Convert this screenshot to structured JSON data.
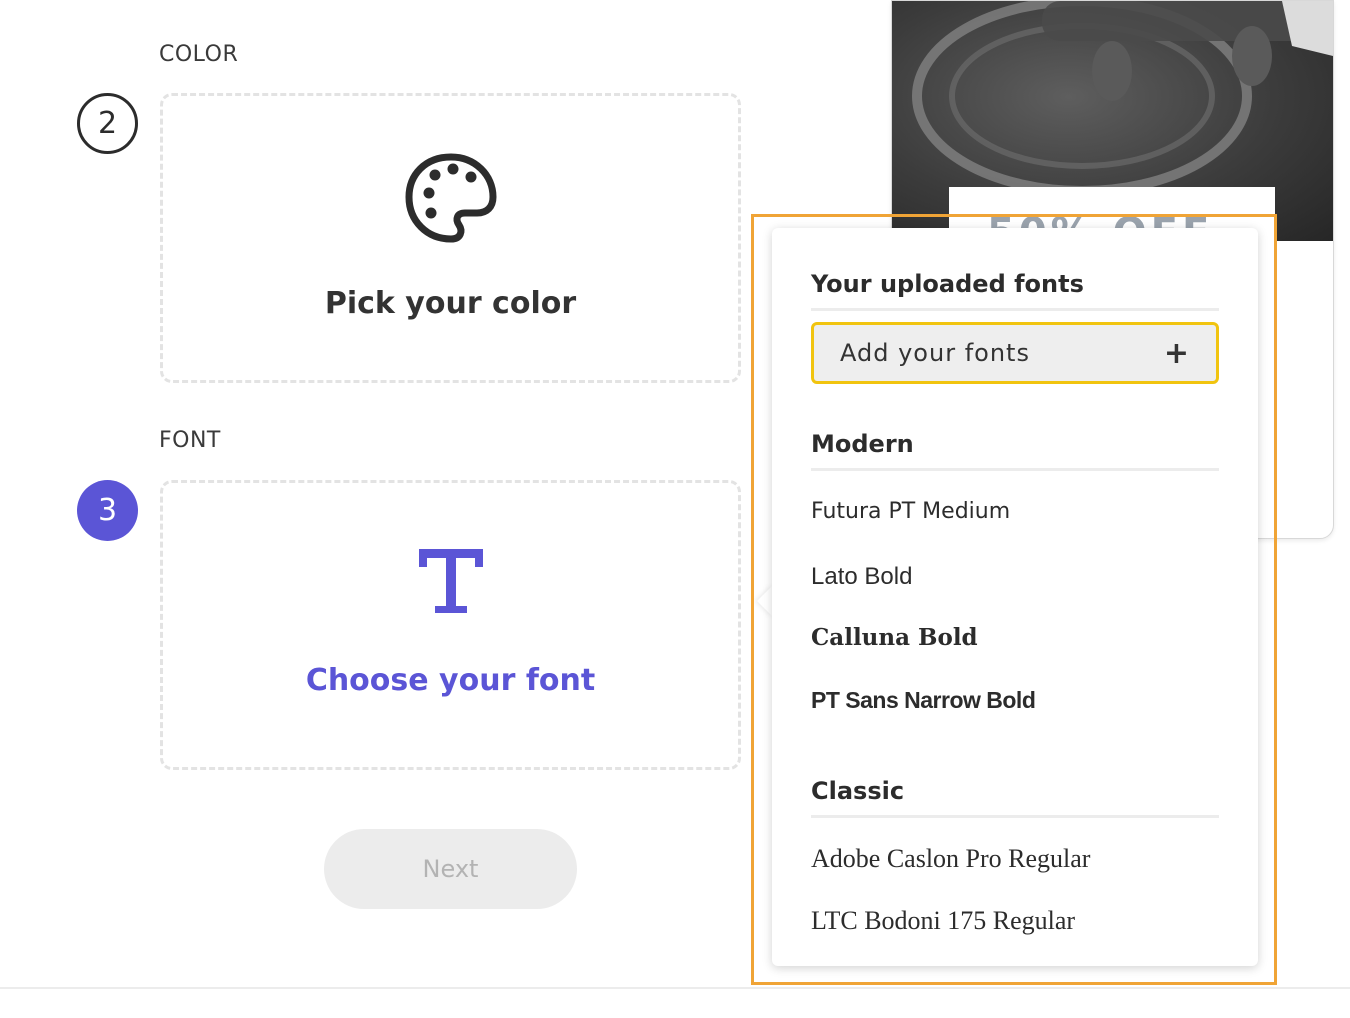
{
  "color_section": {
    "label": "COLOR",
    "step_number": "2",
    "card_title": "Pick your color",
    "icon": "palette-icon"
  },
  "font_section": {
    "label": "FONT",
    "step_number": "3",
    "card_title": "Choose your font",
    "icon": "text-t-icon"
  },
  "next_button": {
    "label": "Next"
  },
  "photo_card": {
    "partial_text": "50% OFF"
  },
  "font_dropdown": {
    "uploaded_heading": "Your uploaded fonts",
    "add_fonts_label": "Add your fonts",
    "add_icon": "plus-icon",
    "groups": [
      {
        "heading": "Modern",
        "fonts": [
          "Futura PT Medium",
          "Lato Bold",
          "Calluna Bold",
          "PT Sans Narrow Bold"
        ]
      },
      {
        "heading": "Classic",
        "fonts": [
          "Adobe Caslon Pro Regular",
          "LTC Bodoni 175 Regular"
        ]
      }
    ]
  },
  "colors": {
    "accent": "#5b55d6",
    "highlight_border": "#f0a436",
    "add_fonts_border": "#f1c40f"
  }
}
